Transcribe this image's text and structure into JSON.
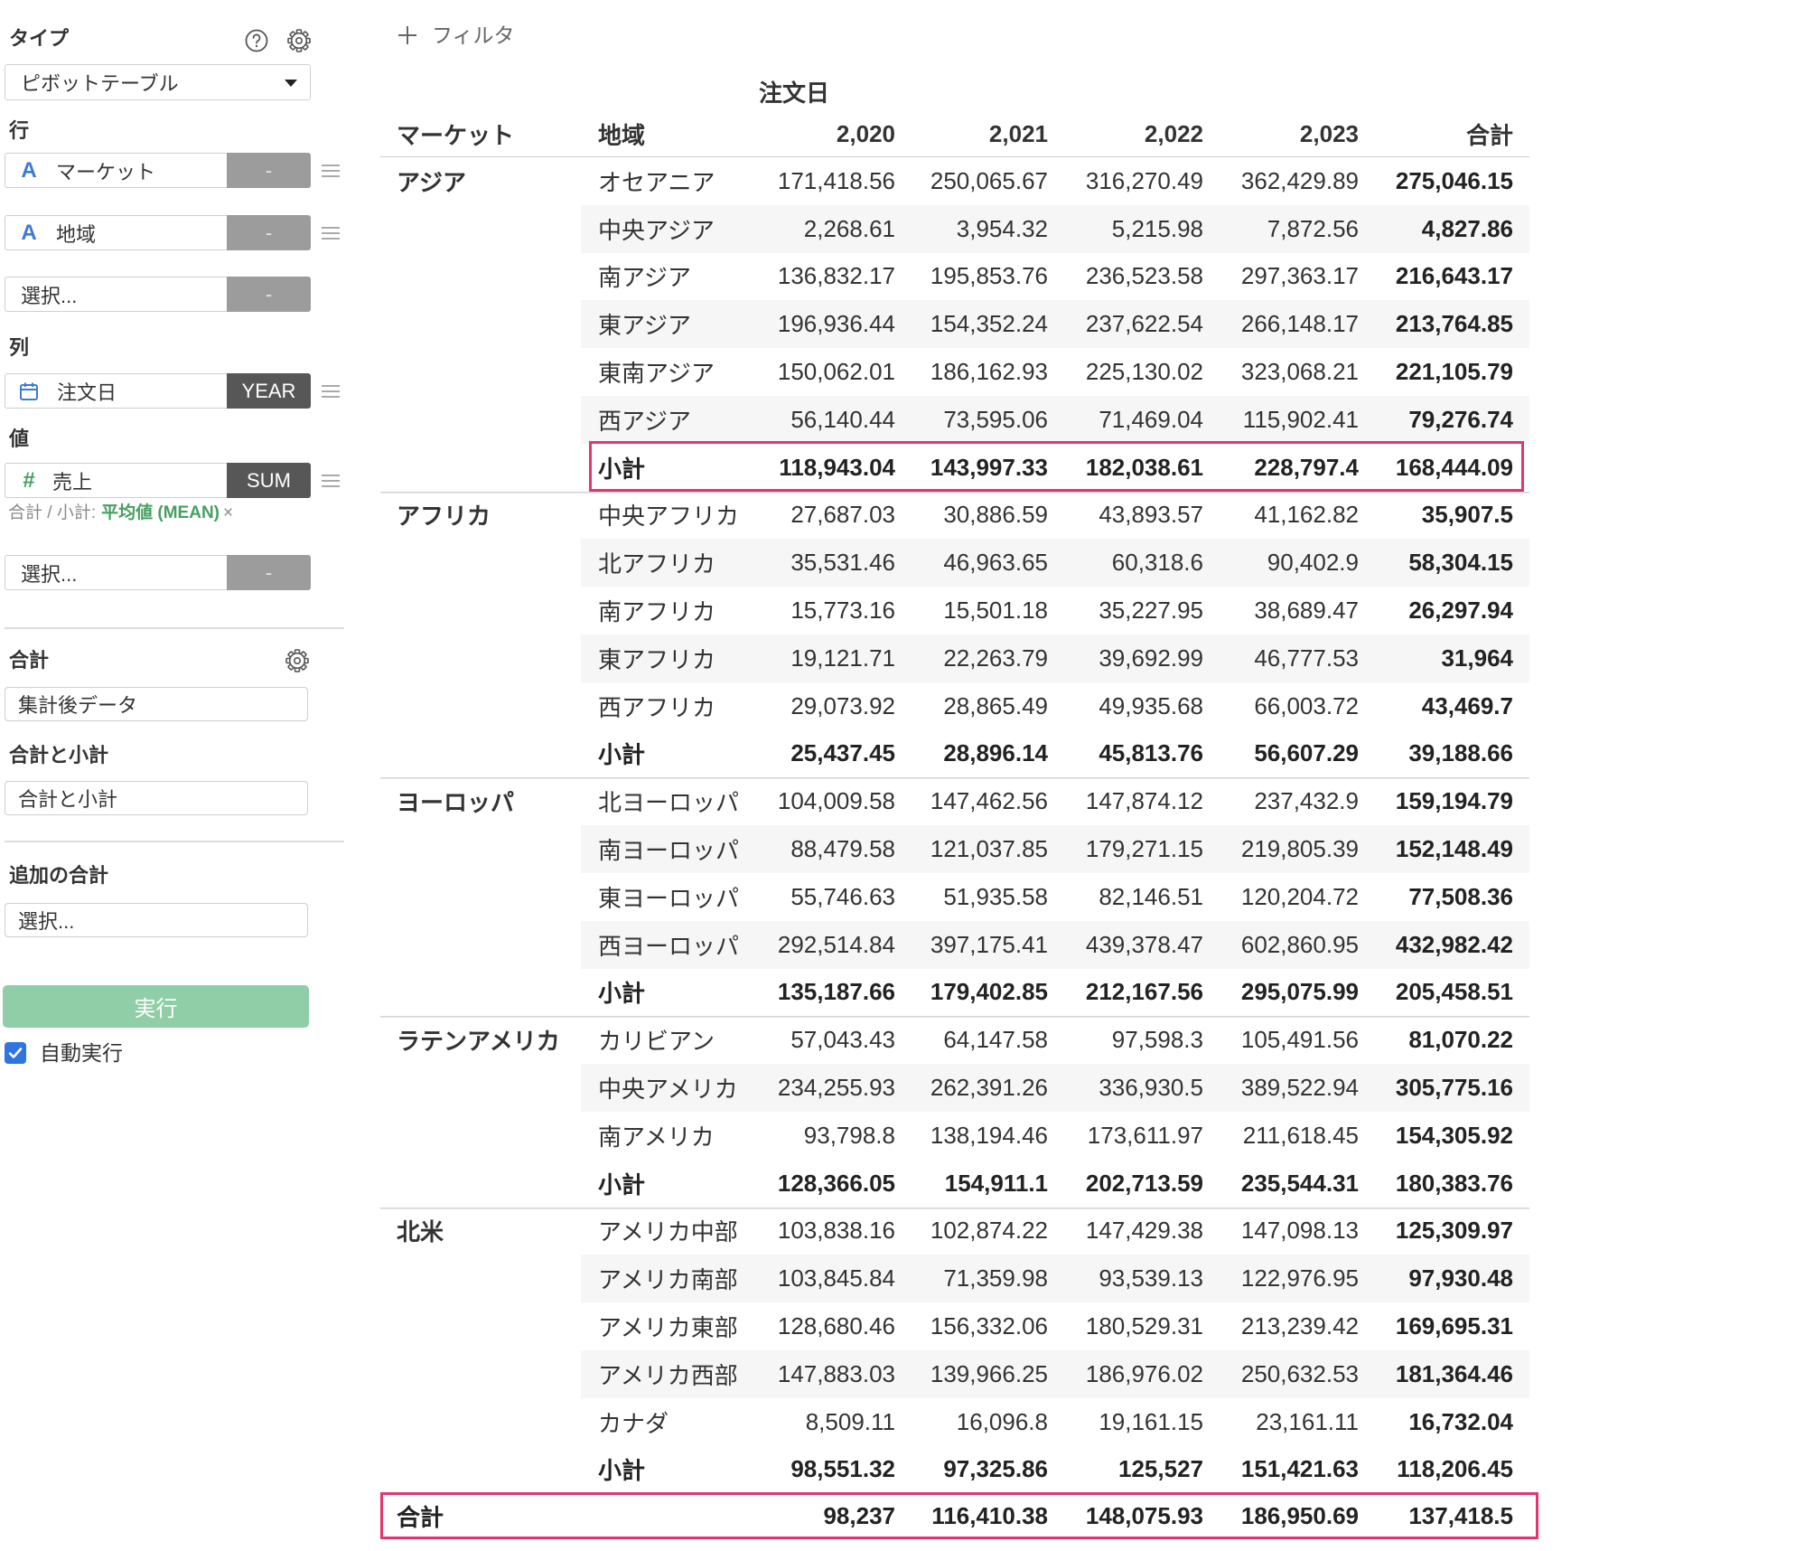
{
  "colors": {
    "highlight": "#e2376d",
    "run_button": "#8fcea6",
    "string_icon": "#3a7bd5",
    "number_icon": "#45a05e",
    "checkbox": "#2f74e0"
  },
  "sidebar": {
    "type": {
      "label": "タイプ",
      "value": "ピボットテーブル",
      "icons": [
        "help-icon",
        "gear-icon"
      ]
    },
    "rows": {
      "label": "行",
      "fields": [
        {
          "type_icon": "A",
          "name": "マーケット",
          "button": "-"
        },
        {
          "type_icon": "A",
          "name": "地域",
          "button": "-"
        },
        {
          "placeholder": "選択...",
          "button": "-"
        }
      ]
    },
    "columns": {
      "label": "列",
      "field": {
        "icon": "calendar-icon",
        "name": "注文日",
        "button": "YEAR"
      }
    },
    "values": {
      "label": "値",
      "field": {
        "type_icon": "#",
        "name": "売上",
        "button": "SUM"
      },
      "total_note": {
        "prefix": "合計 / 小計:",
        "value": "平均値 (MEAN)",
        "remove": "×"
      },
      "select": {
        "placeholder": "選択...",
        "button": "-"
      }
    },
    "totals": {
      "label": "合計",
      "value": "集計後データ",
      "icon": "gear-icon"
    },
    "totals_and_subtotals": {
      "label": "合計と小計",
      "value": "合計と小計"
    },
    "additional_totals": {
      "label": "追加の合計",
      "placeholder": "選択..."
    },
    "run_button": "実行",
    "auto_run": {
      "label": "自動実行",
      "checked": true
    }
  },
  "filter": {
    "icon": "plus-icon",
    "label": "フィルタ"
  },
  "table": {
    "column_group": "注文日",
    "headers": {
      "market": "マーケット",
      "region": "地域",
      "years": [
        "2,020",
        "2,021",
        "2,022",
        "2,023"
      ],
      "total": "合計"
    },
    "groups": [
      {
        "market": "アジア",
        "rows": [
          {
            "region": "オセアニア",
            "values": [
              "171,418.56",
              "250,065.67",
              "316,270.49",
              "362,429.89"
            ],
            "total": "275,046.15"
          },
          {
            "region": "中央アジア",
            "values": [
              "2,268.61",
              "3,954.32",
              "5,215.98",
              "7,872.56"
            ],
            "total": "4,827.86"
          },
          {
            "region": "南アジア",
            "values": [
              "136,832.17",
              "195,853.76",
              "236,523.58",
              "297,363.17"
            ],
            "total": "216,643.17"
          },
          {
            "region": "東アジア",
            "values": [
              "196,936.44",
              "154,352.24",
              "237,622.54",
              "266,148.17"
            ],
            "total": "213,764.85"
          },
          {
            "region": "東南アジア",
            "values": [
              "150,062.01",
              "186,162.93",
              "225,130.02",
              "323,068.21"
            ],
            "total": "221,105.79"
          },
          {
            "region": "西アジア",
            "values": [
              "56,140.44",
              "73,595.06",
              "71,469.04",
              "115,902.41"
            ],
            "total": "79,276.74"
          }
        ],
        "subtotal": {
          "label": "小計",
          "values": [
            "118,943.04",
            "143,997.33",
            "182,038.61",
            "228,797.4"
          ],
          "total": "168,444.09"
        }
      },
      {
        "market": "アフリカ",
        "rows": [
          {
            "region": "中央アフリカ",
            "values": [
              "27,687.03",
              "30,886.59",
              "43,893.57",
              "41,162.82"
            ],
            "total": "35,907.5"
          },
          {
            "region": "北アフリカ",
            "values": [
              "35,531.46",
              "46,963.65",
              "60,318.6",
              "90,402.9"
            ],
            "total": "58,304.15"
          },
          {
            "region": "南アフリカ",
            "values": [
              "15,773.16",
              "15,501.18",
              "35,227.95",
              "38,689.47"
            ],
            "total": "26,297.94"
          },
          {
            "region": "東アフリカ",
            "values": [
              "19,121.71",
              "22,263.79",
              "39,692.99",
              "46,777.53"
            ],
            "total": "31,964"
          },
          {
            "region": "西アフリカ",
            "values": [
              "29,073.92",
              "28,865.49",
              "49,935.68",
              "66,003.72"
            ],
            "total": "43,469.7"
          }
        ],
        "subtotal": {
          "label": "小計",
          "values": [
            "25,437.45",
            "28,896.14",
            "45,813.76",
            "56,607.29"
          ],
          "total": "39,188.66"
        }
      },
      {
        "market": "ヨーロッパ",
        "rows": [
          {
            "region": "北ヨーロッパ",
            "values": [
              "104,009.58",
              "147,462.56",
              "147,874.12",
              "237,432.9"
            ],
            "total": "159,194.79"
          },
          {
            "region": "南ヨーロッパ",
            "values": [
              "88,479.58",
              "121,037.85",
              "179,271.15",
              "219,805.39"
            ],
            "total": "152,148.49"
          },
          {
            "region": "東ヨーロッパ",
            "values": [
              "55,746.63",
              "51,935.58",
              "82,146.51",
              "120,204.72"
            ],
            "total": "77,508.36"
          },
          {
            "region": "西ヨーロッパ",
            "values": [
              "292,514.84",
              "397,175.41",
              "439,378.47",
              "602,860.95"
            ],
            "total": "432,982.42"
          }
        ],
        "subtotal": {
          "label": "小計",
          "values": [
            "135,187.66",
            "179,402.85",
            "212,167.56",
            "295,075.99"
          ],
          "total": "205,458.51"
        }
      },
      {
        "market": "ラテンアメリカ",
        "rows": [
          {
            "region": "カリビアン",
            "values": [
              "57,043.43",
              "64,147.58",
              "97,598.3",
              "105,491.56"
            ],
            "total": "81,070.22"
          },
          {
            "region": "中央アメリカ",
            "values": [
              "234,255.93",
              "262,391.26",
              "336,930.5",
              "389,522.94"
            ],
            "total": "305,775.16"
          },
          {
            "region": "南アメリカ",
            "values": [
              "93,798.8",
              "138,194.46",
              "173,611.97",
              "211,618.45"
            ],
            "total": "154,305.92"
          }
        ],
        "subtotal": {
          "label": "小計",
          "values": [
            "128,366.05",
            "154,911.1",
            "202,713.59",
            "235,544.31"
          ],
          "total": "180,383.76"
        }
      },
      {
        "market": "北米",
        "rows": [
          {
            "region": "アメリカ中部",
            "values": [
              "103,838.16",
              "102,874.22",
              "147,429.38",
              "147,098.13"
            ],
            "total": "125,309.97"
          },
          {
            "region": "アメリカ南部",
            "values": [
              "103,845.84",
              "71,359.98",
              "93,539.13",
              "122,976.95"
            ],
            "total": "97,930.48"
          },
          {
            "region": "アメリカ東部",
            "values": [
              "128,680.46",
              "156,332.06",
              "180,529.31",
              "213,239.42"
            ],
            "total": "169,695.31"
          },
          {
            "region": "アメリカ西部",
            "values": [
              "147,883.03",
              "139,966.25",
              "186,976.02",
              "250,632.53"
            ],
            "total": "181,364.46"
          },
          {
            "region": "カナダ",
            "values": [
              "8,509.11",
              "16,096.8",
              "19,161.15",
              "23,161.11"
            ],
            "total": "16,732.04"
          }
        ],
        "subtotal": {
          "label": "小計",
          "values": [
            "98,551.32",
            "97,325.86",
            "125,527",
            "151,421.63"
          ],
          "total": "118,206.45"
        }
      }
    ],
    "grand_total": {
      "label": "合計",
      "values": [
        "98,237",
        "116,410.38",
        "148,075.93",
        "186,950.69"
      ],
      "total": "137,418.5"
    }
  }
}
